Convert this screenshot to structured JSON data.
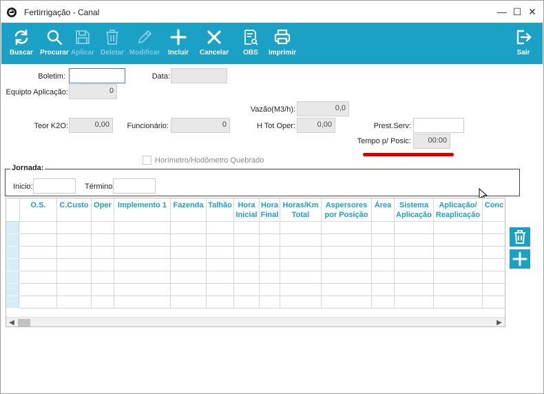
{
  "window": {
    "title": "Fertirrigação - Canal",
    "controls": {
      "minimize": "—",
      "maximize": "☐",
      "close": "✕"
    }
  },
  "toolbar": {
    "buttons": [
      {
        "label": "Buscar",
        "icon": "refresh-icon",
        "enabled": true
      },
      {
        "label": "Procurar",
        "icon": "search-icon",
        "enabled": true
      },
      {
        "label": "Aplicar",
        "icon": "save-icon",
        "enabled": false
      },
      {
        "label": "Deletar",
        "icon": "trash-icon",
        "enabled": false
      },
      {
        "label": "Modificar",
        "icon": "pencil-icon",
        "enabled": false
      },
      {
        "label": "Incluir",
        "icon": "plus-icon",
        "enabled": true
      },
      {
        "label": "Cancelar",
        "icon": "x-icon",
        "enabled": true
      },
      {
        "label": "OBS",
        "icon": "document-search-icon",
        "enabled": true
      },
      {
        "label": "Imprimir",
        "icon": "printer-icon",
        "enabled": true
      },
      {
        "label": "Sair",
        "icon": "exit-icon",
        "enabled": true
      }
    ]
  },
  "form": {
    "boletim": {
      "label": "Boletim:",
      "value": ""
    },
    "data": {
      "label": "Data:",
      "value": ""
    },
    "equipto_aplicacao": {
      "label": "Equipto Aplicação:",
      "value": "0"
    },
    "vazao": {
      "label": "Vazão(M3/h):",
      "value": "0,0"
    },
    "teor_k2o": {
      "label": "Teor K2O:",
      "value": "0,00"
    },
    "funcionario": {
      "label": "Funcionário:",
      "value": "0"
    },
    "h_tot_oper": {
      "label": "H Tot Oper:",
      "value": "0,00"
    },
    "prest_serv": {
      "label": "Prest.Serv:",
      "value": ""
    },
    "tempo_posic": {
      "label": "Tempo p/ Posic:",
      "value": "00:00"
    },
    "horimetro_checkbox": {
      "label": "Horímetro/Hodômetro Quebrado",
      "checked": false
    }
  },
  "jornada": {
    "legend": "Jornada:",
    "inicio": {
      "label": "Inicio:",
      "value": ""
    },
    "termino": {
      "label": "Término:",
      "value": ""
    }
  },
  "grid": {
    "columns": [
      {
        "line1": "O.S.",
        "line2": ""
      },
      {
        "line1": "C.Custo",
        "line2": ""
      },
      {
        "line1": "Oper",
        "line2": ""
      },
      {
        "line1": "Implemento 1",
        "line2": ""
      },
      {
        "line1": "Fazenda",
        "line2": ""
      },
      {
        "line1": "Talhão",
        "line2": ""
      },
      {
        "line1": "Hora",
        "line2": "Inicial"
      },
      {
        "line1": "Hora",
        "line2": "Final"
      },
      {
        "line1": "Horas/Km",
        "line2": "Total"
      },
      {
        "line1": "Aspersores",
        "line2": "por Posição"
      },
      {
        "line1": "Área",
        "line2": ""
      },
      {
        "line1": "Sistema",
        "line2": "Aplicação"
      },
      {
        "line1": "Aplicação/",
        "line2": "Reaplicação"
      },
      {
        "line1": "Conc",
        "line2": ""
      }
    ],
    "empty_rows": 7
  },
  "side_buttons": [
    {
      "icon": "trash-icon"
    },
    {
      "icon": "plus-icon"
    }
  ],
  "colors": {
    "accent": "#1ba1c6",
    "highlight_underline": "#d40000"
  }
}
